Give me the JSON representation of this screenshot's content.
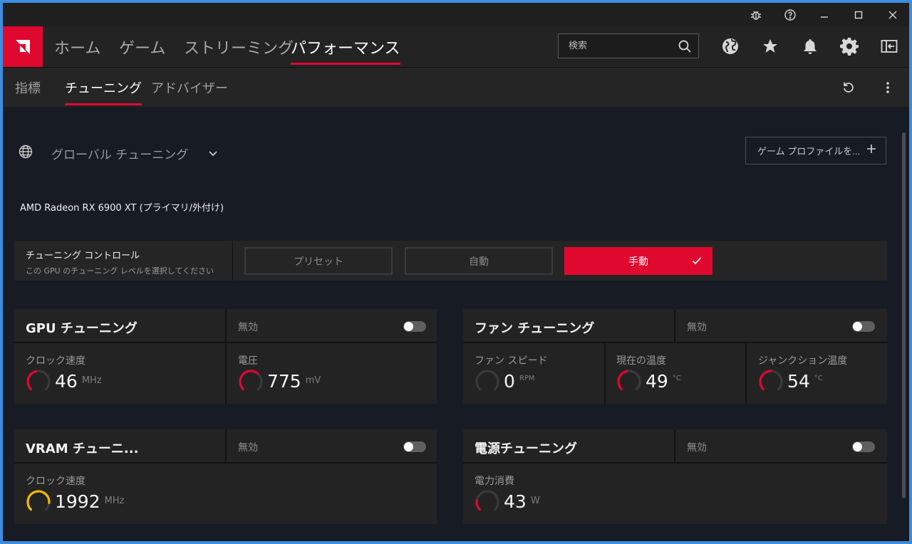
{
  "titlebar": {
    "icons": [
      "bug-icon",
      "help-icon",
      "minimize-icon",
      "maximize-icon",
      "close-icon"
    ]
  },
  "nav": {
    "tabs": [
      {
        "label": "ホーム"
      },
      {
        "label": "ゲーム"
      },
      {
        "label": "ストリーミング"
      },
      {
        "label": "パフォーマンス",
        "active": true
      }
    ],
    "search_placeholder": "検索",
    "icons": [
      "globe-icon",
      "star-icon",
      "bell-icon",
      "gear-icon",
      "sidebar-icon"
    ]
  },
  "subnav": {
    "tabs": [
      {
        "label": "指標"
      },
      {
        "label": "チューニング",
        "active": true
      },
      {
        "label": "アドバイザー"
      }
    ]
  },
  "profile": {
    "label": "グローバル チューニング",
    "game_profile_button": "ゲーム プロファイルを..."
  },
  "gpu_name": "AMD Radeon RX 6900 XT (プライマリ/外付け)",
  "tuning_control": {
    "title": "チューニング コントロール",
    "subtitle": "この GPU のチューニング レベルを選択してください",
    "modes": [
      {
        "label": "プリセット"
      },
      {
        "label": "自動"
      },
      {
        "label": "手動",
        "active": true
      }
    ]
  },
  "panels": {
    "gpu": {
      "title": "GPU チューニング",
      "state": "無効",
      "metrics": [
        {
          "label": "クロック速度",
          "value": "46",
          "unit": "MHz",
          "fill": 0.45
        },
        {
          "label": "電圧",
          "value": "775",
          "unit": "mV",
          "fill": 0.65
        }
      ]
    },
    "fan": {
      "title": "ファン チューニング",
      "state": "無効",
      "metrics": [
        {
          "label": "ファン スピード",
          "value": "0",
          "unit": "RPM",
          "fill": 0.0
        },
        {
          "label": "現在の温度",
          "value": "49",
          "unit": "°C",
          "fill": 0.45
        },
        {
          "label": "ジャンクション温度",
          "value": "54",
          "unit": "°C",
          "fill": 0.5
        }
      ]
    },
    "vram": {
      "title": "VRAM チューニ...",
      "state": "無効",
      "metrics": [
        {
          "label": "クロック速度",
          "value": "1992",
          "unit": "MHz",
          "fill": 0.85
        }
      ]
    },
    "power": {
      "title": "電源チューニング",
      "state": "無効",
      "metrics": [
        {
          "label": "電力消費",
          "value": "43",
          "unit": "W",
          "fill": 0.2
        }
      ]
    }
  },
  "colors": {
    "accent": "#e0082f",
    "gauge_track": "#3a3a3a",
    "gauge_warning": "#f5b800",
    "background": "#171b24",
    "panel": "#232323"
  }
}
